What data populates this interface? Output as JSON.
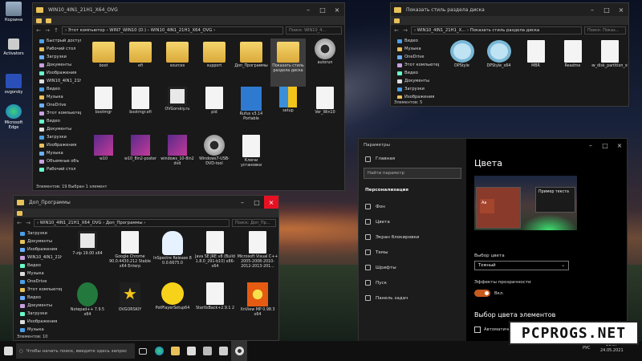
{
  "desktop": {
    "icons": [
      {
        "label": "Корзина"
      },
      {
        "label": "Activators"
      },
      {
        "label": "ovgorsky"
      },
      {
        "label": "Microsoft Edge"
      }
    ]
  },
  "explorer1": {
    "title": "WIN10_4IN1_21H1_X64_OVG",
    "path": "› Этот компьютер › WIN7_WIN10 (D:) › WIN10_4IN1_21H1_X64_OVG ›",
    "search": "Поиск: WIN10_4...",
    "nav": [
      {
        "label": "Быстрый доступ"
      },
      {
        "label": "Рабочий стол"
      },
      {
        "label": "Загрузки"
      },
      {
        "label": "Документы"
      },
      {
        "label": "Изображения"
      },
      {
        "label": "WIN10_4IN1_21H1"
      },
      {
        "label": "Видео"
      },
      {
        "label": "Музыка"
      },
      {
        "label": "OneDrive"
      },
      {
        "label": "Этот компьютер"
      },
      {
        "label": "Видео"
      },
      {
        "label": "Документы"
      },
      {
        "label": "Загрузки"
      },
      {
        "label": "Изображения"
      },
      {
        "label": "Музыка"
      },
      {
        "label": "Объемные объ"
      },
      {
        "label": "Рабочий стол"
      }
    ],
    "files": [
      {
        "name": "boot",
        "icon": "folder"
      },
      {
        "name": "efi",
        "icon": "folder"
      },
      {
        "name": "sources",
        "icon": "folder"
      },
      {
        "name": "support",
        "icon": "folder"
      },
      {
        "name": "Доп_Программы",
        "icon": "folder"
      },
      {
        "name": "Показать стиль раздела диска",
        "icon": "folder"
      },
      {
        "name": "autorun",
        "icon": "gear"
      },
      {
        "name": "bootmgr",
        "icon": "doc"
      },
      {
        "name": "bootmgr.efi",
        "icon": "doc"
      },
      {
        "name": "OVGorskiy.ru",
        "icon": "dark"
      },
      {
        "name": "pid",
        "icon": "doc"
      },
      {
        "name": "Rufus v3.14 Portable",
        "icon": "blue"
      },
      {
        "name": "setup",
        "icon": "shield"
      },
      {
        "name": "Ver_Win10",
        "icon": "doc"
      },
      {
        "name": "w10",
        "icon": "win10"
      },
      {
        "name": "w10_8in2-poster",
        "icon": "win10"
      },
      {
        "name": "windows_10-8in2 dvd",
        "icon": "win10"
      },
      {
        "name": "Windows7-USB-DVD-tool",
        "icon": "gear"
      },
      {
        "name": "Ключи установки",
        "icon": "doc"
      }
    ],
    "status": "Элементов: 19    Выбран 1 элемент"
  },
  "explorer2": {
    "title": "Показать стиль раздела диска",
    "path": "› WIN10_4IN1_21H1_X... › Показать стиль раздела диска",
    "search": "Поиск: Показ...",
    "nav": [
      {
        "label": "Видео"
      },
      {
        "label": "Музыка"
      },
      {
        "label": "OneDrive"
      },
      {
        "label": "Этот компьютер"
      },
      {
        "label": "Видео"
      },
      {
        "label": "Документы"
      },
      {
        "label": "Загрузки"
      },
      {
        "label": "Изображения"
      }
    ],
    "files": [
      {
        "name": "DPStyle",
        "icon": "mag"
      },
      {
        "name": "DPStyle_x64",
        "icon": "mag"
      },
      {
        "name": "MBR",
        "icon": "doc"
      },
      {
        "name": "Readme",
        "icon": "doc"
      },
      {
        "name": "Show_disk_partition_style",
        "icon": "doc"
      }
    ],
    "status": "Элементов: 5"
  },
  "explorer3": {
    "title": "Доп_Программы",
    "path": "› WIN10_4IN1_21H1_X64_OVG › Доп_Программы ›",
    "search": "Поиск: Доп_Пр...",
    "nav": [
      {
        "label": "Загрузки"
      },
      {
        "label": "Документы"
      },
      {
        "label": "Изображения"
      },
      {
        "label": "WIN10_4IN1_21H1"
      },
      {
        "label": "Видео"
      },
      {
        "label": "Музыка"
      },
      {
        "label": "OneDrive"
      },
      {
        "label": "Этот компьютер"
      },
      {
        "label": "Видео"
      },
      {
        "label": "Документы"
      },
      {
        "label": "Загрузки"
      },
      {
        "label": "Изображения"
      },
      {
        "label": "Музыка"
      }
    ],
    "files": [
      {
        "name": "7-zip 19.00 x64",
        "icon": "dark"
      },
      {
        "name": "Google Chrome 90.0.4430.212 Stable x64 Enterp",
        "icon": "doc"
      },
      {
        "name": "InSpectre Release 8 0.0.6675.0",
        "icon": "ghost"
      },
      {
        "name": "Java SE JRE v8 (Build 1.8.0_291-b10) x86-x64",
        "icon": "doc"
      },
      {
        "name": "Microsoft Visual C++ 2005-2008-2010-2012-2013-201...",
        "icon": "doc"
      },
      {
        "name": "Notepad++ 7.9.5 x64",
        "icon": "green"
      },
      {
        "name": "OVGORSKIY",
        "icon": "star"
      },
      {
        "name": "PotPlayerSetup64",
        "icon": "play"
      },
      {
        "name": "StartIsBack+2.9.1 2",
        "icon": "doc"
      },
      {
        "name": "XnView MP 0.98.3 x64",
        "icon": "orange"
      }
    ],
    "status": "Элементов: 10"
  },
  "settings": {
    "title": "Параметры",
    "home": "Главная",
    "search_placeholder": "Найти параметр",
    "section": "Персонализация",
    "menu": [
      {
        "label": "Фон"
      },
      {
        "label": "Цвета"
      },
      {
        "label": "Экран блокировки"
      },
      {
        "label": "Темы"
      },
      {
        "label": "Шрифты"
      },
      {
        "label": "Пуск"
      },
      {
        "label": "Панель задач"
      }
    ],
    "heading": "Цвета",
    "preview_text": "Пример текста",
    "preview_tile": "Aa",
    "color_choice_label": "Выбор цвета",
    "color_choice_value": "Темный",
    "transparency_label": "Эффекты прозрачности",
    "transparency_value": "Вкл.",
    "accent_heading": "Выбор цвета элементов",
    "auto_label": "Автоматический выбор"
  },
  "taskbar": {
    "search_placeholder": "Чтобы начать поиск, введите здесь запрос",
    "lang": "РУС",
    "time": "21:07",
    "date": "24.05.2021"
  },
  "watermark": "PCPROGS.NET"
}
